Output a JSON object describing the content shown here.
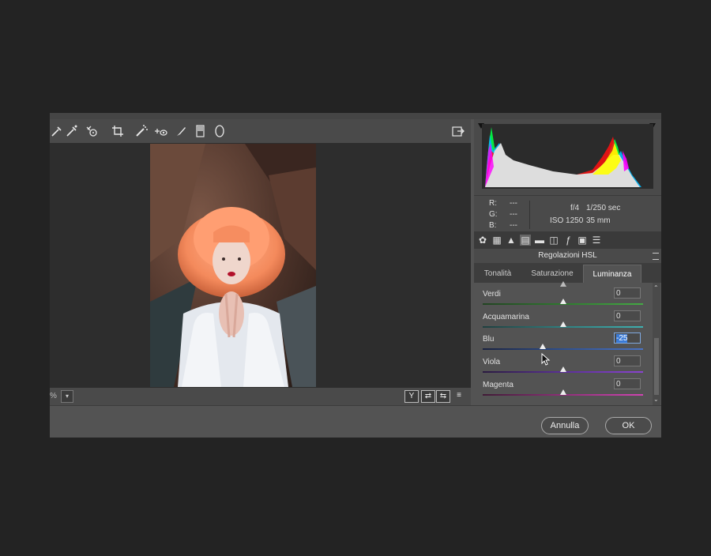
{
  "toolbar": {
    "icons": [
      "white-balance-icon",
      "color-sampler-icon",
      "targeted-adjustment-icon",
      "crop-icon",
      "spot-removal-icon",
      "red-eye-icon",
      "adjustment-brush-icon",
      "graduated-filter-icon",
      "radial-filter-icon"
    ],
    "open_object_icon": "open-object-icon"
  },
  "bottombar": {
    "zoom_text": "%",
    "zoom_dropdown": "▾",
    "buttons": [
      "Y",
      "⇄",
      "⇆",
      "≡"
    ]
  },
  "info": {
    "r_label": "R:",
    "g_label": "G:",
    "b_label": "B:",
    "r_val": "---",
    "g_val": "---",
    "b_val": "---",
    "aperture": "f/4",
    "shutter": "1/250 sec",
    "iso": "ISO 1250",
    "focal": "35 mm"
  },
  "panel": {
    "title": "Regolazioni HSL",
    "tabs": [
      "Tonalità",
      "Saturazione",
      "Luminanza"
    ],
    "active_tab": 2
  },
  "sliders": [
    {
      "label": "Verdi",
      "value": "0",
      "pos": 0.5,
      "gradient": "linear-gradient(90deg,#224422,#2e7a2e,#44aa44)"
    },
    {
      "label": "Acquamarina",
      "value": "0",
      "pos": 0.5,
      "gradient": "linear-gradient(90deg,#1f3f3f,#2f8080,#3fb0b0)"
    },
    {
      "label": "Blu",
      "value": "-25",
      "pos": 0.375,
      "gradient": "linear-gradient(90deg,#1a2240,#2d4f8f,#4a73c5)",
      "selected": true
    },
    {
      "label": "Viola",
      "value": "0",
      "pos": 0.5,
      "gradient": "linear-gradient(90deg,#2a1a40,#5b2f99,#8a44d0)"
    },
    {
      "label": "Magenta",
      "value": "0",
      "pos": 0.5,
      "gradient": "linear-gradient(90deg,#401a36,#8f2f79,#d044b2)"
    }
  ],
  "footer": {
    "cancel": "Annulla",
    "ok": "OK"
  },
  "colors": {
    "accent": "#3a7ad6",
    "bg": "#232323",
    "dialog": "#535353"
  }
}
